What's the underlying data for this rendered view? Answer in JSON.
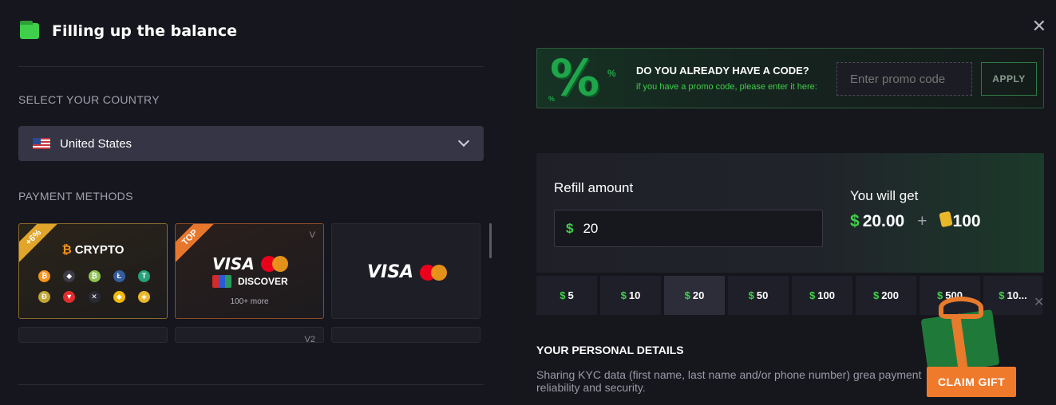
{
  "header": {
    "title": "Filling up the balance"
  },
  "country": {
    "section_label": "SELECT YOUR COUNTRY",
    "selected": "United States"
  },
  "payment": {
    "section_label": "PAYMENT METHODS",
    "cards": [
      {
        "ribbon": "+6%",
        "title": "CRYPTO"
      },
      {
        "ribbon": "TOP",
        "brand1": "VISA",
        "brand2": "DISCOVER",
        "more": "100+ more",
        "badge": "V"
      },
      {
        "brand1": "VISA"
      },
      {
        "badge": "V2"
      }
    ]
  },
  "promo": {
    "title": "DO YOU ALREADY HAVE A CODE?",
    "subtitle": "if you have a promo code, please enter it here:",
    "placeholder": "Enter promo code",
    "apply_label": "APPLY"
  },
  "refill": {
    "label": "Refill amount",
    "currency_symbol": "$",
    "amount": "20",
    "get_label": "You will get",
    "get_amount": "20.00",
    "plus": "+",
    "bonus": "100"
  },
  "amount_chips": [
    {
      "label": "5"
    },
    {
      "label": "10"
    },
    {
      "label": "20",
      "active": true
    },
    {
      "label": "50"
    },
    {
      "label": "100"
    },
    {
      "label": "200"
    },
    {
      "label": "500"
    },
    {
      "label": "10..."
    }
  ],
  "personal": {
    "title": "YOUR PERSONAL DETAILS",
    "text": "Sharing KYC data (first name, last name and/or phone number) grea payment reliability and security."
  },
  "gift": {
    "claim_label": "CLAIM GIFT"
  },
  "colors": {
    "accent_green": "#3fcf4a",
    "accent_orange": "#f07a2c",
    "bg": "#16161e"
  }
}
